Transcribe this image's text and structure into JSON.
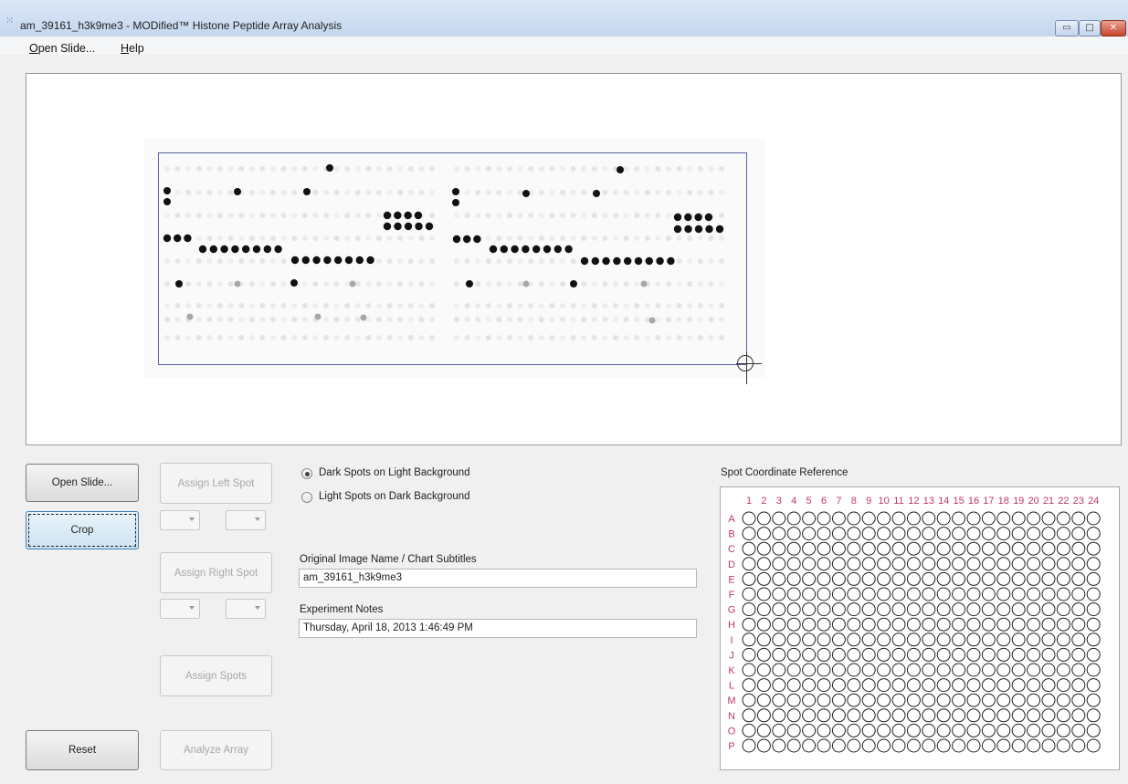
{
  "window": {
    "title": "am_39161_h3k9me3 - MODified™ Histone Peptide Array Analysis",
    "minimize_glyph": "▭",
    "maximize_glyph": "□",
    "close_glyph": "✕"
  },
  "menu": [
    {
      "label": "Open Slide...",
      "accel": "O"
    },
    {
      "label": "Help",
      "accel": "H"
    }
  ],
  "buttons": {
    "open_slide": "Open Slide...",
    "crop": "Crop",
    "reset": "Reset",
    "assign_left": "Assign Left Spot",
    "assign_right": "Assign Right Spot",
    "assign_spots": "Assign Spots",
    "analyze": "Analyze Array"
  },
  "background_mode": {
    "options": [
      {
        "label": "Dark Spots on Light Background",
        "checked": true
      },
      {
        "label": "Light Spots on Dark Background",
        "checked": false
      }
    ]
  },
  "fields": {
    "image_name_label": "Original Image Name / Chart Subtitles",
    "image_name_value": "am_39161_h3k9me3",
    "notes_label": "Experiment Notes",
    "notes_value": "Thursday, April 18, 2013 1:46:49 PM"
  },
  "reference": {
    "title": "Spot Coordinate Reference",
    "columns": [
      "1",
      "2",
      "3",
      "4",
      "5",
      "6",
      "7",
      "8",
      "9",
      "10",
      "11",
      "12",
      "13",
      "14",
      "15",
      "16",
      "17",
      "18",
      "19",
      "20",
      "21",
      "22",
      "23",
      "24"
    ],
    "rows": [
      "A",
      "B",
      "C",
      "D",
      "E",
      "F",
      "G",
      "H",
      "I",
      "J",
      "K",
      "L",
      "M",
      "N",
      "O",
      "P"
    ],
    "label_color": "#c0385e"
  },
  "colors": {
    "accent_focus": "#3c7fb1",
    "crop_rect": "#5b62a8"
  }
}
